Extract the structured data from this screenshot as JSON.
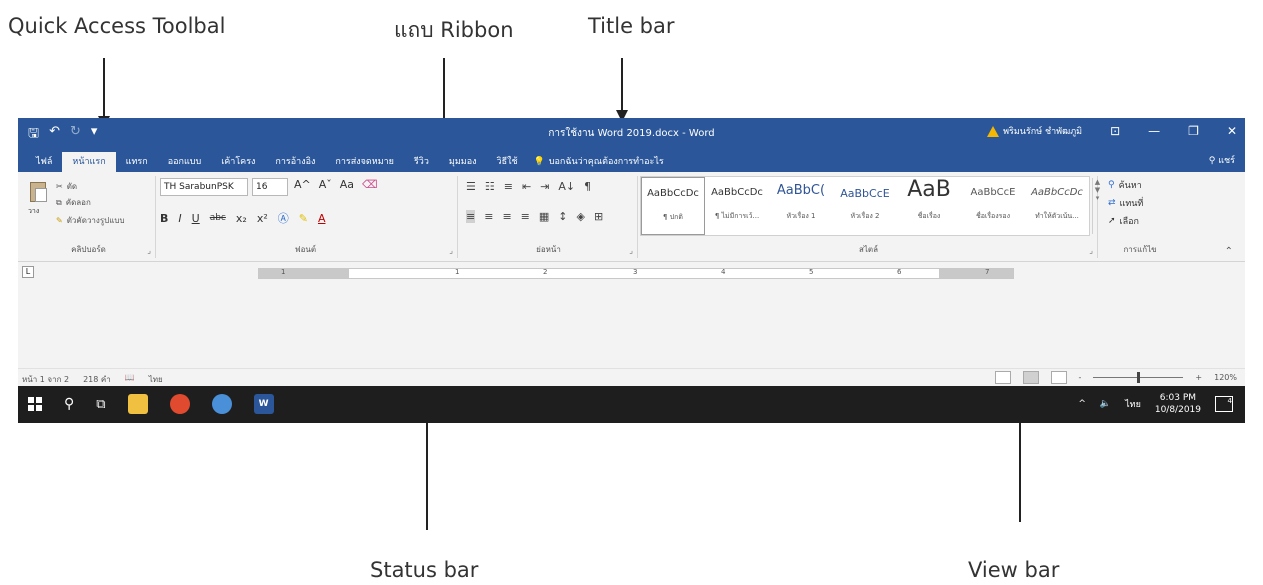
{
  "annotations": {
    "quick_access": "Quick Access Toolbal",
    "ribbon": "แถบ Ribbon",
    "title_bar": "Title bar",
    "status_bar": "Status bar",
    "view_bar": "View bar"
  },
  "titlebar": {
    "title": "การใช้งาน Word 2019.docx - Word",
    "user": "พริมนรักษ์ ชำพัฒภูมิ",
    "qat_save": "🖫",
    "qat_undo": "↶",
    "qat_redo": "↻",
    "qat_more": "▾",
    "min": "—",
    "restore": "❐",
    "close": "✕",
    "ribbon_opts": "⊡"
  },
  "tabs": [
    {
      "label": "ไฟล์"
    },
    {
      "label": "หน้าแรก"
    },
    {
      "label": "แทรก"
    },
    {
      "label": "ออกแบบ"
    },
    {
      "label": "เค้าโครง"
    },
    {
      "label": "การอ้างอิง"
    },
    {
      "label": "การส่งจดหมาย"
    },
    {
      "label": "รีวิว"
    },
    {
      "label": "มุมมอง"
    },
    {
      "label": "วิธีใช้"
    }
  ],
  "tellme": "บอกฉันว่าคุณต้องการทำอะไร",
  "share": "แชร์",
  "ribbon": {
    "clipboard": {
      "name": "คลิปบอร์ด",
      "paste": "วาง",
      "cut": "ตัด",
      "copy": "คัดลอก",
      "format_painter": "ตัวคัดวางรูปแบบ"
    },
    "font": {
      "name": "ฟอนต์",
      "font_name": "TH SarabunPSK",
      "font_size": "16",
      "bold": "B",
      "italic": "I",
      "underline": "U",
      "strike": "abc",
      "subscript": "x₂",
      "superscript": "x²",
      "grow": "A^",
      "shrink": "Aˇ",
      "case": "Aa",
      "color": "A"
    },
    "paragraph": {
      "name": "ย่อหน้า",
      "sort": "A↓",
      "pilcrow": "¶"
    },
    "styles": {
      "name": "สไตล์",
      "items": [
        {
          "sample": "AaBbCcDc",
          "name": "¶ ปกติ"
        },
        {
          "sample": "AaBbCcDc",
          "name": "¶ ไม่มีการเว้..."
        },
        {
          "sample": "AaBbC(",
          "name": "หัวเรื่อง 1"
        },
        {
          "sample": "AaBbCcE",
          "name": "หัวเรื่อง 2"
        },
        {
          "sample": "AaB",
          "name": "ชื่อเรื่อง"
        },
        {
          "sample": "AaBbCcE",
          "name": "ชื่อเรื่องรอง"
        },
        {
          "sample": "AaBbCcDc",
          "name": "ทำให้ตัวเน้น..."
        }
      ]
    },
    "editing": {
      "name": "การแก้ไข",
      "find": "ค้นหา",
      "replace": "แทนที่",
      "select": "เลือก"
    }
  },
  "ruler": {
    "numbers": [
      "1",
      "1",
      "2",
      "3",
      "4",
      "5",
      "6",
      "7"
    ]
  },
  "statusbar": {
    "page": "หน้า 1 จาก 2",
    "words": "218 คำ",
    "language": "ไทย",
    "zoom": "120%",
    "zoom_minus": "-",
    "zoom_plus": "+"
  },
  "taskbar": {
    "time": "6:03 PM",
    "date": "10/8/2019",
    "lang": "ไทย",
    "notif_count": "4",
    "word_label": "W"
  }
}
